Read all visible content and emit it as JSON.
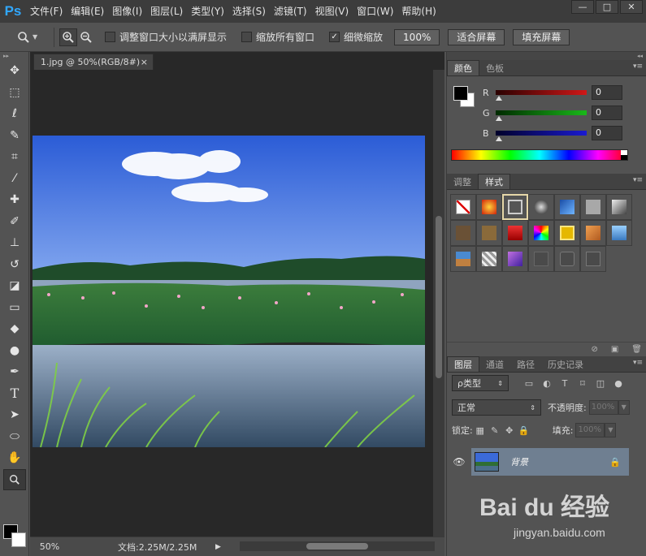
{
  "app": {
    "logo": "Ps",
    "window_controls": [
      "—",
      "□",
      "✕"
    ]
  },
  "menu": [
    "文件(F)",
    "编辑(E)",
    "图像(I)",
    "图层(L)",
    "类型(Y)",
    "选择(S)",
    "滤镜(T)",
    "视图(V)",
    "窗口(W)",
    "帮助(H)"
  ],
  "options": {
    "resize_windows_label": "调整窗口大小以满屏显示",
    "resize_windows_checked": false,
    "zoom_all_label": "缩放所有窗口",
    "zoom_all_checked": false,
    "scrubby_zoom_label": "细微缩放",
    "scrubby_zoom_checked": true,
    "btn_100": "100%",
    "btn_fit": "适合屏幕",
    "btn_fill": "填充屏幕"
  },
  "document": {
    "tab_title": "1.jpg @ 50%(RGB/8#)",
    "tab_close": "×",
    "status_zoom": "50%",
    "status_doc": "文档:2.25M/2.25M"
  },
  "color_panel": {
    "tabs": [
      "颜色",
      "色板"
    ],
    "channels": [
      {
        "label": "R",
        "value": "0",
        "color": "#d01818"
      },
      {
        "label": "G",
        "value": "0",
        "color": "#19b819"
      },
      {
        "label": "B",
        "value": "0",
        "color": "#1a1ad0"
      }
    ]
  },
  "styles_panel": {
    "tabs": [
      "调整",
      "样式"
    ]
  },
  "layers_panel": {
    "tabs": [
      "图层",
      "通道",
      "路径",
      "历史记录"
    ],
    "filter_kind": "ρ类型",
    "blend_mode": "正常",
    "opacity_label": "不透明度:",
    "opacity_value": "100%",
    "lock_label": "锁定:",
    "fill_label": "填充:",
    "fill_value": "100%",
    "layer_name": "背景"
  },
  "watermark": {
    "text": "Bai du 经验",
    "sub": "jingyan.baidu.com"
  }
}
